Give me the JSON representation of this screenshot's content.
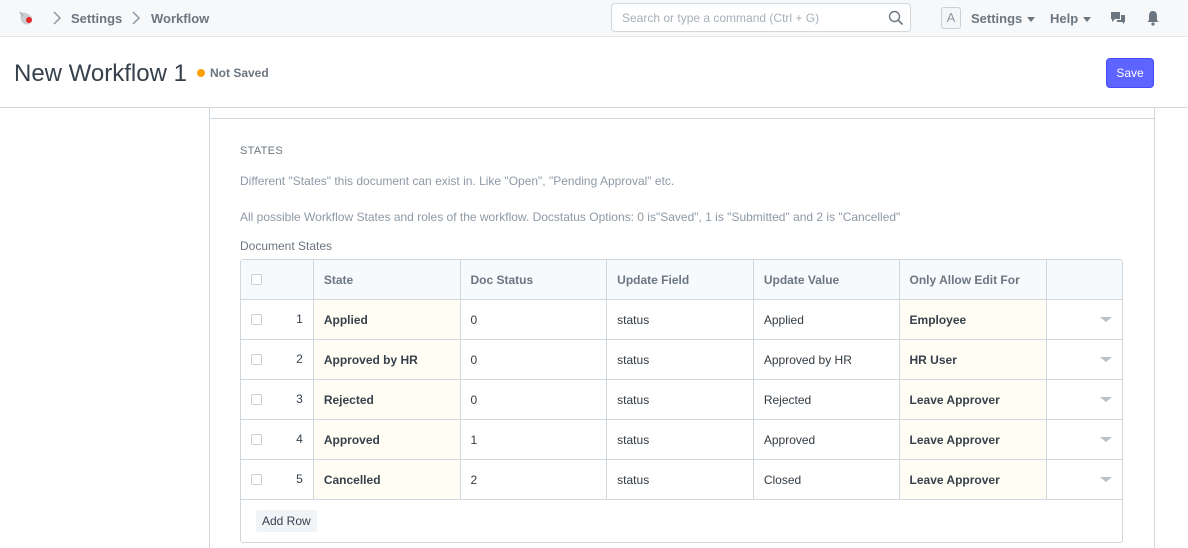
{
  "navbar": {
    "breadcrumbs": [
      "Settings",
      "Workflow"
    ],
    "search_placeholder": "Search or type a command (Ctrl + G)",
    "avatar_letter": "A",
    "settings_label": "Settings",
    "help_label": "Help"
  },
  "page": {
    "title": "New Workflow 1",
    "status": "Not Saved",
    "save_label": "Save"
  },
  "section": {
    "heading": "STATES",
    "desc1": "Different \"States\" this document can exist in. Like \"Open\", \"Pending Approval\" etc.",
    "desc2": "All possible Workflow States and roles of the workflow. Docstatus Options: 0 is\"Saved\", 1 is \"Submitted\" and 2 is \"Cancelled\"",
    "grid_label": "Document States"
  },
  "grid": {
    "columns": [
      "State",
      "Doc Status",
      "Update Field",
      "Update Value",
      "Only Allow Edit For"
    ],
    "rows": [
      {
        "idx": "1",
        "state": "Applied",
        "doc_status": "0",
        "update_field": "status",
        "update_value": "Applied",
        "allow": "Employee"
      },
      {
        "idx": "2",
        "state": "Approved by HR",
        "doc_status": "0",
        "update_field": "status",
        "update_value": "Approved by HR",
        "allow": "HR User"
      },
      {
        "idx": "3",
        "state": "Rejected",
        "doc_status": "0",
        "update_field": "status",
        "update_value": "Rejected",
        "allow": "Leave Approver"
      },
      {
        "idx": "4",
        "state": "Approved",
        "doc_status": "1",
        "update_field": "status",
        "update_value": "Approved",
        "allow": "Leave Approver"
      },
      {
        "idx": "5",
        "state": "Cancelled",
        "doc_status": "2",
        "update_field": "status",
        "update_value": "Closed",
        "allow": "Leave Approver"
      }
    ],
    "add_row_label": "Add Row"
  },
  "colors": {
    "primary": "#5e64ff",
    "indicator": "#ffa00a",
    "logo_red": "#e9272b"
  }
}
